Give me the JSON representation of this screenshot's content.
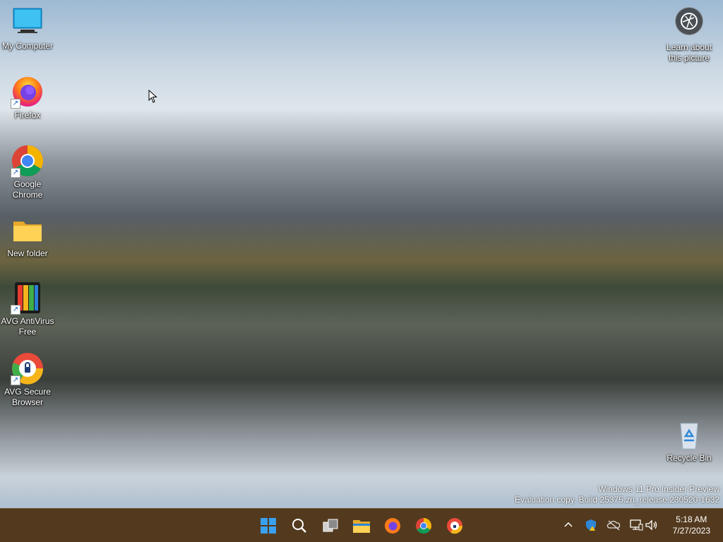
{
  "desktop": {
    "icons": [
      {
        "label": "My Computer",
        "icon": "monitor-icon"
      },
      {
        "label": "Firefox",
        "icon": "firefox-icon"
      },
      {
        "label": "Google Chrome",
        "icon": "chrome-icon"
      },
      {
        "label": "New folder",
        "icon": "folder-icon"
      },
      {
        "label": "AVG AntiVirus Free",
        "icon": "avg-antivirus-icon"
      },
      {
        "label": "AVG Secure Browser",
        "icon": "avg-secure-browser-icon"
      }
    ],
    "learn_about_picture": {
      "label": "Learn about this picture",
      "icon": "camera-icon"
    },
    "recycle_bin": {
      "label": "Recycle Bin",
      "icon": "recycle-bin-icon"
    },
    "watermark": {
      "line1": "Windows 11 Pro Insider Preview",
      "line2": "Evaluation copy. Build 25375.zn_release.230520-1632"
    }
  },
  "taskbar": {
    "background": "#533a1e",
    "apps": [
      "start-icon",
      "search-icon",
      "task-view-icon",
      "file-explorer-icon",
      "firefox-icon",
      "chrome-icon",
      "avg-secure-browser-icon"
    ],
    "tray": [
      "chevron-up-icon",
      "windows-security-icon",
      "onedrive-icon",
      "network-icon",
      "volume-icon"
    ],
    "clock": {
      "time": "5:18 AM",
      "date": "7/27/2023"
    }
  }
}
